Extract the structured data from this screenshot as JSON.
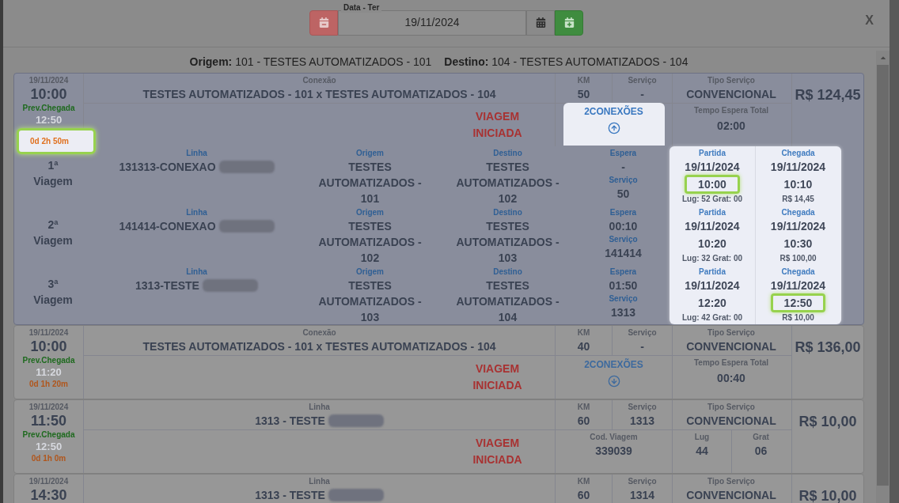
{
  "date_picker": {
    "label": "Data - Ter",
    "value": "19/11/2024"
  },
  "close": "X",
  "route_header": [
    "**Origem:** 101 - TESTES AUTOMATIZADOS - 101",
    "**Destino:** 104 - TESTES AUTOMATIZADOS - 104"
  ],
  "trips": [
    {
      "kind": "connection",
      "selected": true,
      "date": "19/11/2024",
      "departure": "10:00",
      "arrival_label": "Prev.Chegada",
      "arrival": "12:50",
      "duration": "0d 2h 50m",
      "duration_highlighted": true,
      "route_label": "Conexão",
      "route": "TESTES AUTOMATIZADOS - 101 x TESTES AUTOMATIZADOS - 104",
      "redacted": false,
      "km_label": "KM",
      "km": "50",
      "service_label": "Serviço",
      "service": "-",
      "type_label": "Tipo Serviço",
      "type": "CONVENCIONAL",
      "price": "R$ 124,45",
      "status": "VIAGEM INICIADA",
      "connections": {
        "label": "2CONEXÕES",
        "expanded": true
      },
      "wait_total_label": "Tempo Espera Total",
      "wait_total": "02:00",
      "legs": [
        {
          "ordinal": "1ª Viagem",
          "line_label": "Linha",
          "line": "131313-CONEXAO",
          "redacted": true,
          "origin_label": "Origem",
          "origin": "TESTES AUTOMATIZADOS - 101",
          "destination_label": "Destino",
          "destination": "TESTES AUTOMATIZADOS - 102",
          "wait_label": "Espera",
          "wait": "-",
          "service_label": "Serviço",
          "service": "50",
          "departure": {
            "label": "Partida",
            "date": "19/11/2024",
            "time": "10:00",
            "highlighted": true,
            "extra": "Lug: 52 Grat: 00"
          },
          "arrival": {
            "label": "Chegada",
            "date": "19/11/2024",
            "time": "10:10",
            "highlighted": false,
            "extra": "R$ 14,45"
          }
        },
        {
          "ordinal": "2ª Viagem",
          "line_label": "Linha",
          "line": "141414-CONEXAO",
          "redacted": true,
          "origin_label": "Origem",
          "origin": "TESTES AUTOMATIZADOS - 102",
          "destination_label": "Destino",
          "destination": "TESTES AUTOMATIZADOS - 103",
          "wait_label": "Espera",
          "wait": "00:10",
          "service_label": "Serviço",
          "service": "141414",
          "departure": {
            "label": "Partida",
            "date": "19/11/2024",
            "time": "10:20",
            "highlighted": false,
            "extra": "Lug: 32 Grat: 00"
          },
          "arrival": {
            "label": "Chegada",
            "date": "19/11/2024",
            "time": "10:30",
            "highlighted": false,
            "extra": "R$ 100,00"
          }
        },
        {
          "ordinal": "3ª Viagem",
          "line_label": "Linha",
          "line": "1313-TESTE",
          "redacted": true,
          "origin_label": "Origem",
          "origin": "TESTES AUTOMATIZADOS - 103",
          "destination_label": "Destino",
          "destination": "TESTES AUTOMATIZADOS - 104",
          "wait_label": "Espera",
          "wait": "01:50",
          "service_label": "Serviço",
          "service": "1313",
          "departure": {
            "label": "Partida",
            "date": "19/11/2024",
            "time": "12:20",
            "highlighted": false,
            "extra": "Lug: 42 Grat: 00"
          },
          "arrival": {
            "label": "Chegada",
            "date": "19/11/2024",
            "time": "12:50",
            "highlighted": true,
            "extra": "R$ 10,00"
          }
        }
      ]
    },
    {
      "kind": "connection",
      "selected": false,
      "date": "19/11/2024",
      "departure": "10:00",
      "arrival_label": "Prev.Chegada",
      "arrival": "11:20",
      "duration": "0d 1h 20m",
      "duration_highlighted": false,
      "route_label": "Conexão",
      "route": "TESTES AUTOMATIZADOS - 101 x TESTES AUTOMATIZADOS - 104",
      "redacted": false,
      "km_label": "KM",
      "km": "40",
      "service_label": "Serviço",
      "service": "-",
      "type_label": "Tipo Serviço",
      "type": "CONVENCIONAL",
      "price": "R$ 136,00",
      "status": "VIAGEM INICIADA",
      "connections": {
        "label": "2CONEXÕES",
        "expanded": false
      },
      "wait_total_label": "Tempo Espera Total",
      "wait_total": "00:40"
    },
    {
      "kind": "direct",
      "selected": false,
      "date": "19/11/2024",
      "departure": "11:50",
      "arrival_label": "Prev.Chegada",
      "arrival": "12:50",
      "duration": "0d 1h 0m",
      "duration_highlighted": false,
      "route_label": "Linha",
      "route": "1313 - TESTE",
      "redacted": true,
      "km_label": "KM",
      "km": "60",
      "service_label": "Serviço",
      "service": "1313",
      "type_label": "Tipo Serviço",
      "type": "CONVENCIONAL",
      "price": "R$ 10,00",
      "status": "VIAGEM INICIADA",
      "code_label": "Cod. Viagem",
      "code": "339039",
      "seats_label": "Lug",
      "seats": "44",
      "free_label": "Grat",
      "free": "06"
    },
    {
      "kind": "direct",
      "selected": false,
      "date": "19/11/2024",
      "departure": "14:30",
      "route_label": "Linha",
      "route": "1313 - TESTE",
      "redacted": true,
      "km_label": "KM",
      "km": "60",
      "service_label": "Serviço",
      "service": "1314",
      "type_label": "Tipo Serviço",
      "type": "CONVENCIONAL",
      "price": "R$ 10,00"
    }
  ]
}
